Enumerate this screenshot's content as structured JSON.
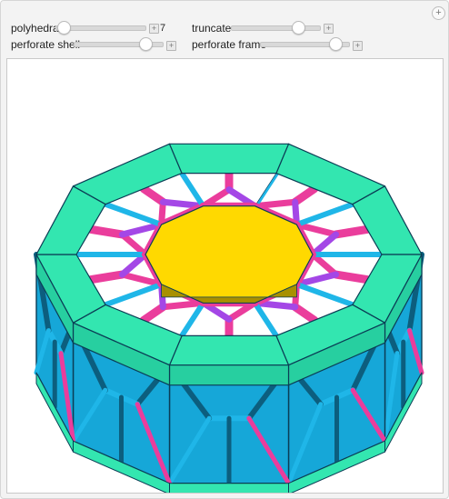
{
  "controls": [
    {
      "label": "polyhedra",
      "value": "7",
      "level": 0.05
    },
    {
      "label": "truncate",
      "level": 0.75
    },
    {
      "label": "perforate shell",
      "level": 0.8
    },
    {
      "label": "perforate frame",
      "level": 0.85
    }
  ],
  "icons": {
    "stepper": "plus-icon",
    "corner": "plus-circle-icon"
  },
  "colors": {
    "frame": "#33e6b0",
    "hole": "#ffd900",
    "cyan": "#1fb6e8",
    "pink": "#ea3d9c",
    "purple": "#a447e6",
    "dark": "#0c5e7e"
  }
}
